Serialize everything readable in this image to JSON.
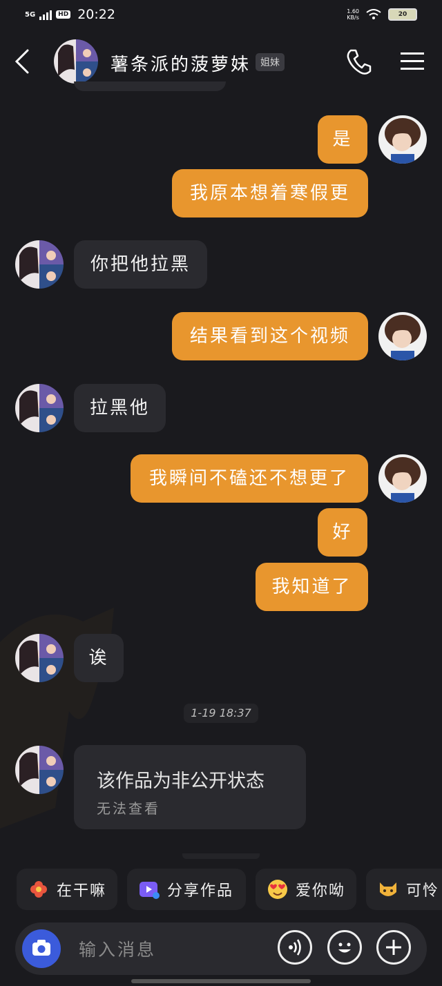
{
  "status_bar": {
    "network": "5G",
    "hd": "HD",
    "time": "20:22",
    "speed": "1.60",
    "speed_unit": "KB/s",
    "battery": "20"
  },
  "header": {
    "title": "薯条派的菠萝妹",
    "tag": "姐妹"
  },
  "messages": [
    {
      "side": "right",
      "text": "是"
    },
    {
      "side": "right",
      "text": "我原本想着寒假更"
    },
    {
      "side": "left",
      "text": "你把他拉黑"
    },
    {
      "side": "right",
      "text": "结果看到这个视频"
    },
    {
      "side": "left",
      "text": "拉黑他"
    },
    {
      "side": "right",
      "text": "我瞬间不磕还不想更了"
    },
    {
      "side": "right",
      "text": "好"
    },
    {
      "side": "right",
      "text": "我知道了"
    },
    {
      "side": "left",
      "text": "诶"
    }
  ],
  "timestamp": "1-19 18:37",
  "private_card": {
    "title": "该作品为非公开状态",
    "subtitle": "无法查看"
  },
  "quick_replies": [
    {
      "label": "在干嘛",
      "icon": "flower-icon"
    },
    {
      "label": "分享作品",
      "icon": "video-share-icon"
    },
    {
      "label": "爱你呦",
      "icon": "heart-eyes-emoji-icon"
    },
    {
      "label": "可怜",
      "icon": "cat-emoji-icon"
    }
  ],
  "input": {
    "placeholder": "输入消息"
  },
  "colors": {
    "background": "#1a1a1e",
    "sent_bubble": "#e8962e",
    "received_bubble": "#2a2a2f",
    "camera_button": "#3b5bdb"
  }
}
